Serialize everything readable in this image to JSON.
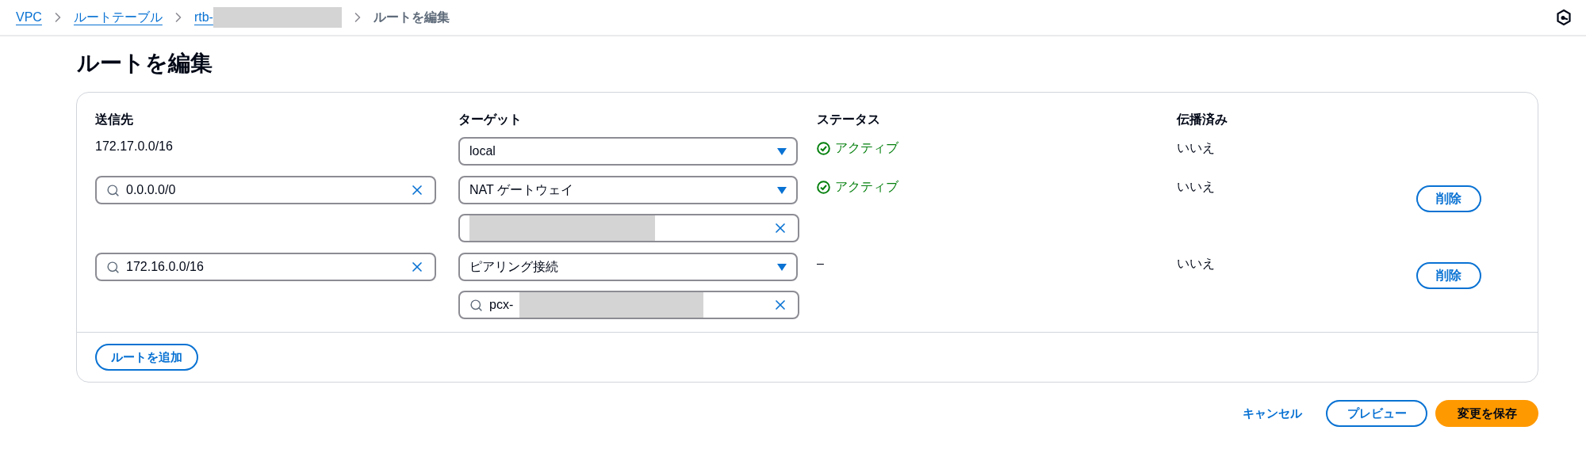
{
  "breadcrumb": {
    "items": [
      {
        "label": "VPC",
        "kind": "link"
      },
      {
        "label": "ルートテーブル",
        "kind": "link"
      },
      {
        "label": "rtb-",
        "kind": "redacted-link"
      },
      {
        "label": "ルートを編集",
        "kind": "current"
      }
    ]
  },
  "title": "ルートを編集",
  "table": {
    "columns": [
      "送信先",
      "ターゲット",
      "ステータス",
      "伝播済み"
    ],
    "rows": [
      {
        "destination": {
          "kind": "text",
          "value": "172.17.0.0/16"
        },
        "target": {
          "value": "local"
        },
        "status": {
          "kind": "active",
          "text": "アクティブ"
        },
        "propagated": "いいえ"
      },
      {
        "destination": {
          "kind": "field",
          "value": "0.0.0.0/0"
        },
        "target": {
          "value": "NAT ゲートウェイ",
          "sub_field": {
            "kind": "plain"
          }
        },
        "status": {
          "kind": "active",
          "text": "アクティブ"
        },
        "propagated": "いいえ",
        "delete_button": "削除"
      },
      {
        "destination": {
          "kind": "field",
          "value": "172.16.0.0/16"
        },
        "target": {
          "value": "ピアリング接続",
          "sub_field": {
            "kind": "search",
            "value": "pcx-"
          }
        },
        "status": {
          "kind": "none",
          "text": "–"
        },
        "propagated": "いいえ",
        "delete_button": "削除"
      }
    ]
  },
  "add_button": "ルートを追加",
  "footer": {
    "cancel": "キャンセル",
    "preview": "プレビュー",
    "save": "変更を保存"
  }
}
